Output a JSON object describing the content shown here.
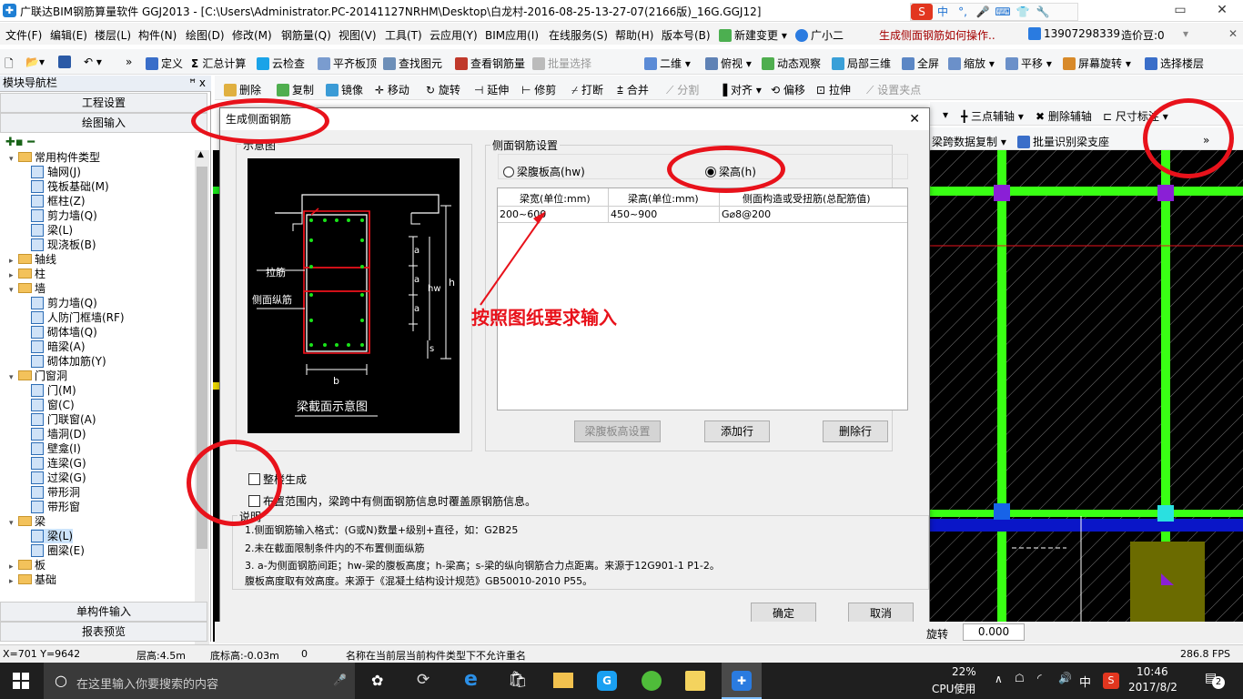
{
  "window": {
    "title": "广联达BIM钢筋算量软件 GGJ2013 - [C:\\Users\\Administrator.PC-20141127NRHM\\Desktop\\白龙村-2016-08-25-13-27-07(2166版)_16G.GGJ12]"
  },
  "ime": [
    "中",
    "°,",
    "🎤",
    "⌨",
    "👕",
    "🔧"
  ],
  "menu": [
    "文件(F)",
    "编辑(E)",
    "楼层(L)",
    "构件(N)",
    "绘图(D)",
    "修改(M)",
    "钢筋量(Q)",
    "视图(V)",
    "工具(T)",
    "云应用(Y)",
    "BIM应用(I)",
    "在线服务(S)",
    "帮助(H)",
    "版本号(B)",
    "新建变更",
    "广小二",
    "生成侧面钢筋如何操作..",
    "13907298339",
    "造价豆:0"
  ],
  "toolbar1": [
    "定义",
    "汇总计算",
    "云检查",
    "平齐板顶",
    "查找图元",
    "查看钢筋量",
    "批量选择",
    "二维",
    "俯视",
    "动态观察",
    "局部三维",
    "全屏",
    "缩放",
    "平移",
    "屏幕旋转",
    "选择楼层"
  ],
  "toolbar2": [
    "删除",
    "复制",
    "镜像",
    "移动",
    "旋转",
    "延伸",
    "修剪",
    "打断",
    "合并",
    "分割",
    "对齐",
    "偏移",
    "拉伸",
    "设置夹点"
  ],
  "toolbar3": [
    "三点辅轴",
    "删除辅轴",
    "尺寸标注"
  ],
  "toolbar4": [
    "梁跨数据复制",
    "批量识别梁支座"
  ],
  "nav": {
    "header": "模块导航栏",
    "pin": "ꟸ x",
    "btn_project": "工程设置",
    "btn_draw": "绘图输入",
    "btn_single": "单构件输入",
    "btn_report": "报表预览",
    "tree": [
      {
        "label": "常用构件类型",
        "level": 0,
        "folder": true,
        "exp": "⊟"
      },
      {
        "label": "轴网(J)",
        "level": 1
      },
      {
        "label": "筏板基础(M)",
        "level": 1
      },
      {
        "label": "框柱(Z)",
        "level": 1
      },
      {
        "label": "剪力墙(Q)",
        "level": 1
      },
      {
        "label": "梁(L)",
        "level": 1
      },
      {
        "label": "现浇板(B)",
        "level": 1
      },
      {
        "label": "轴线",
        "level": 0,
        "folder": true,
        "exp": "⊞"
      },
      {
        "label": "柱",
        "level": 0,
        "folder": true,
        "exp": "⊞"
      },
      {
        "label": "墙",
        "level": 0,
        "folder": true,
        "exp": "⊟"
      },
      {
        "label": "剪力墙(Q)",
        "level": 1
      },
      {
        "label": "人防门框墙(RF)",
        "level": 1
      },
      {
        "label": "砌体墙(Q)",
        "level": 1
      },
      {
        "label": "暗梁(A)",
        "level": 1
      },
      {
        "label": "砌体加筋(Y)",
        "level": 1
      },
      {
        "label": "门窗洞",
        "level": 0,
        "folder": true,
        "exp": "⊟"
      },
      {
        "label": "门(M)",
        "level": 1
      },
      {
        "label": "窗(C)",
        "level": 1
      },
      {
        "label": "门联窗(A)",
        "level": 1
      },
      {
        "label": "墙洞(D)",
        "level": 1
      },
      {
        "label": "壁龛(I)",
        "level": 1
      },
      {
        "label": "连梁(G)",
        "level": 1
      },
      {
        "label": "过梁(G)",
        "level": 1
      },
      {
        "label": "带形洞",
        "level": 1
      },
      {
        "label": "带形窗",
        "level": 1
      },
      {
        "label": "梁",
        "level": 0,
        "folder": true,
        "exp": "⊟"
      },
      {
        "label": "梁(L)",
        "level": 1,
        "selected": true
      },
      {
        "label": "圈梁(E)",
        "level": 1
      },
      {
        "label": "板",
        "level": 0,
        "folder": true,
        "exp": "⊞"
      },
      {
        "label": "基础",
        "level": 0,
        "folder": true,
        "exp": "⊞"
      }
    ]
  },
  "dialog": {
    "title": "生成侧面钢筋",
    "close": "✕",
    "diagram_group": "示意图",
    "diagram": {
      "la": "拉筋",
      "lz": "侧面纵筋",
      "a": "a",
      "hw": "hw",
      "h": "h",
      "s": "s",
      "b": "b",
      "caption": "梁截面示意图"
    },
    "settings_group": "侧面钢筋设置",
    "radio_hw": "梁腹板高(hw)",
    "radio_h": "梁高(h)",
    "table": {
      "headers": [
        "梁宽(单位:mm)",
        "梁高(单位:mm)",
        "侧面构造或受扭筋(总配筋值)"
      ],
      "rows": [
        [
          "200~600",
          "450~900",
          "G⌀8@200"
        ]
      ]
    },
    "btn_hw": "梁腹板高设置",
    "btn_add": "添加行",
    "btn_del": "删除行",
    "chk_whole": "整楼生成",
    "chk_cover": "布置范围内，梁跨中有侧面钢筋信息时覆盖原钢筋信息。",
    "notes_title": "说明",
    "notes": [
      "1.侧面钢筋输入格式：(G或N)数量+级别+直径，如：G2B25",
      "2.未在截面限制条件内的不布置侧面纵筋",
      "3. a-为侧面钢筋间距；hw-梁的腹板高度；h-梁高；s-梁的纵向钢筋合力点距离。来源于12G901-1 P1-2。",
      "   腹板高度取有效高度。来源于《混凝土结构设计规范》GB50010-2010 P55。"
    ],
    "ok": "确定",
    "cancel": "取消"
  },
  "annotation": "按照图纸要求输入",
  "status": {
    "coords": "X=701 Y=9642",
    "floor_h": "层高:4.5m",
    "bottom": "底标高:-0.03m",
    "zero": "0",
    "msg": "名称在当前层当前构件类型下不允许重名",
    "fps": "286.8 FPS"
  },
  "bottom_tools": {
    "rotate": "旋转",
    "rotate_val": "0.000"
  },
  "taskbar": {
    "search": "在这里输入你要搜索的内容",
    "cpu": "22%",
    "cpu_label": "CPU使用",
    "lang": "中",
    "time": "10:46",
    "date": "2017/8/2",
    "notif": "2"
  },
  "colors": {
    "red": "#e8121b",
    "green": "#19e319",
    "beam": "#39ff14"
  }
}
